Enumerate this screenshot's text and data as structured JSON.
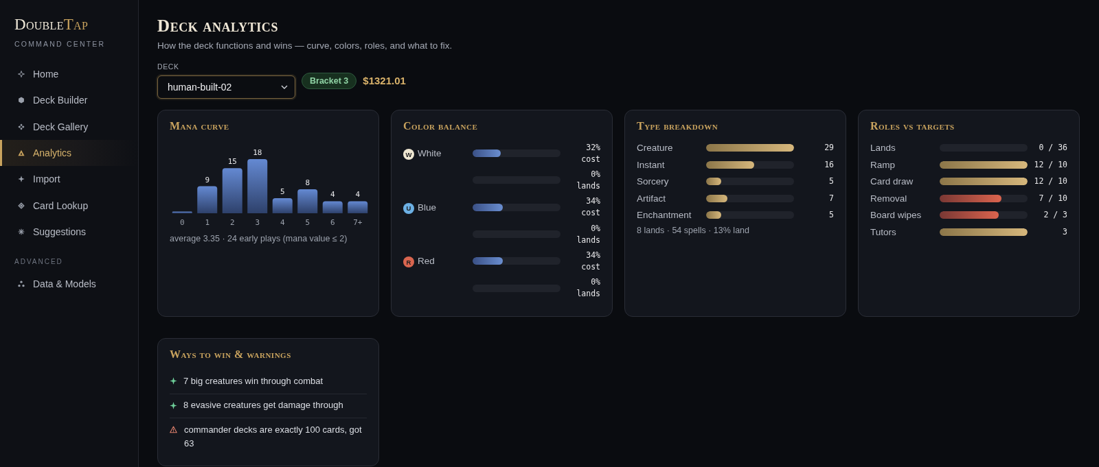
{
  "sidebar": {
    "logo": {
      "text": "Double",
      "accent": "Tap"
    },
    "tagline": "COMMAND CENTER",
    "sections": [
      {
        "items": [
          {
            "label": "Home",
            "selected": false
          },
          {
            "label": "Deck Builder",
            "selected": false
          },
          {
            "label": "Deck Gallery",
            "selected": false
          },
          {
            "label": "Analytics",
            "selected": true
          },
          {
            "label": "Import",
            "selected": false
          },
          {
            "label": "Card Lookup",
            "selected": false
          },
          {
            "label": "Suggestions",
            "selected": false
          }
        ]
      },
      {
        "heading": "ADVANCED",
        "items": [
          {
            "label": "Data & Models",
            "selected": false
          }
        ]
      }
    ]
  },
  "header": {
    "title": "Deck analytics",
    "subtitle": "How the deck functions and wins — curve, colors, roles, and what to fix.",
    "deck_field": {
      "label": "DECK",
      "value": "human-built-02"
    },
    "bracket": "Bracket 3",
    "price": "$1321.01"
  },
  "mana_curve": {
    "title": "Mana curve",
    "chart_data": {
      "type": "bar",
      "categories": [
        "0",
        "1",
        "2",
        "3",
        "4",
        "5",
        "6",
        "7+"
      ],
      "values": [
        0,
        9,
        15,
        18,
        5,
        8,
        4,
        4
      ],
      "value_labels": [
        null,
        "9",
        "15",
        "18",
        "5",
        "8",
        "4",
        "4"
      ]
    },
    "summary": "average 3.35 · 24 early plays (mana value ≤ 2)"
  },
  "color_balance": {
    "title": "Color balance",
    "colors": [
      {
        "symbol": "W",
        "name": "White",
        "color": "#efe7d2",
        "bars": [
          {
            "level": 0.32,
            "reading": "32% cost"
          },
          {
            "level": 0,
            "reading": "0% lands"
          }
        ]
      },
      {
        "symbol": "U",
        "name": "Blue",
        "color": "#6cb0e4",
        "bars": [
          {
            "level": 0.34,
            "reading": "34% cost"
          },
          {
            "level": 0,
            "reading": "0% lands"
          }
        ]
      },
      {
        "symbol": "R",
        "name": "Red",
        "color": "#d9654f",
        "bars": [
          {
            "level": 0.34,
            "reading": "34% cost"
          },
          {
            "level": 0,
            "reading": "0% lands"
          }
        ]
      }
    ]
  },
  "type_breakdown": {
    "title": "Type breakdown",
    "types": [
      {
        "name": "Creature",
        "level": 1,
        "count": "29"
      },
      {
        "name": "Instant",
        "level": 0.55,
        "count": "16"
      },
      {
        "name": "Sorcery",
        "level": 0.17,
        "count": "5"
      },
      {
        "name": "Artifact",
        "level": 0.24,
        "count": "7"
      },
      {
        "name": "Enchantment",
        "level": 0.17,
        "count": "5"
      }
    ],
    "summary": "8 lands · 54 spells · 13% land"
  },
  "roles": {
    "title": "Roles vs targets",
    "items": [
      {
        "name": "Lands",
        "level": 0,
        "reading": "0 / 36"
      },
      {
        "name": "Ramp",
        "level": 1,
        "below_target": false,
        "reading": "12 / 10"
      },
      {
        "name": "Card draw",
        "level": 1,
        "below_target": false,
        "reading": "12 / 10"
      },
      {
        "name": "Removal",
        "level": 0.7,
        "below_target": true,
        "reading": "7 / 10"
      },
      {
        "name": "Board wipes",
        "level": 0.67,
        "below_target": true,
        "reading": "2 / 3"
      },
      {
        "name": "Tutors",
        "level": 1,
        "below_target": false,
        "reading": "3"
      }
    ]
  },
  "ways_to_win": {
    "title": "Ways to win & warnings",
    "items": [
      {
        "kind": "win",
        "text": "7 big creatures win through combat"
      },
      {
        "kind": "win",
        "text": "8 evasive creatures get damage through"
      },
      {
        "kind": "warning",
        "text": "commander decks are exactly 100 cards, got 63"
      }
    ]
  }
}
